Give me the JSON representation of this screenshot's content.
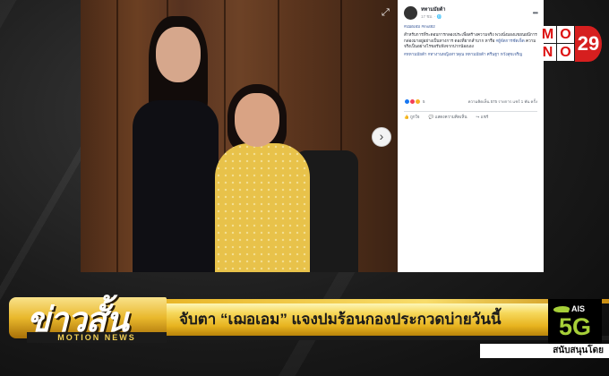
{
  "post": {
    "author": "หทามมัยต้า",
    "time": "17 ชม. · ",
    "more_icon": "more-dots-icon",
    "body_hashtags": "#เฌอเอม #mut82",
    "body_text": "สำหรับการที่ระดอบการกลองประเพื่อสร้างความจริง พวงนั่งมองแขยนยนีการ​กล่องมาอยู่อย่างเป็นทางการ ดองที่​ยากลำบาก หารือ",
    "body_highlight": " #ผู้จัดการชัดเจ็ด",
    "body_text2": " ความจริงเป็นอย่างไรขอรับฟังจากปากน้องเอง",
    "body_tags": "#ทหามมัยต้า #ทางานหญิงสาวดุณ ทหามมัยต้า ศรีนฐา หวังสุขเจริญ",
    "reaction_count": "5",
    "stats": "ความคิดเห็น 575 รายการ  แชร์ 1 พัน ครั้ง",
    "like_label": "ถูกใจ",
    "comment_label": "แสดงความคิดเห็น",
    "share_label": "แชร์"
  },
  "viewer": {
    "expand_icon": "expand-icon",
    "next_icon": "chevron-right-icon",
    "next_glyph": "›",
    "expand_glyph": "⤢"
  },
  "logo": {
    "mono_letters": [
      "M",
      "O",
      "N",
      "O"
    ],
    "number": "29"
  },
  "news": {
    "show_title": "ข่าวสั้น",
    "show_subtitle": "MOTION NEWS",
    "headline": "จับตา “เฌอเอม” แจงปมร้อนกองประกวดบ่ายวันนี้",
    "sponsor_text": "สนับสนุนโดย",
    "ais_label": "AIS",
    "ais_5g": "5G"
  },
  "colors": {
    "accent_gold": "#e7b31f",
    "channel_red": "#d61f1f",
    "ais_green": "#a6cf38"
  }
}
